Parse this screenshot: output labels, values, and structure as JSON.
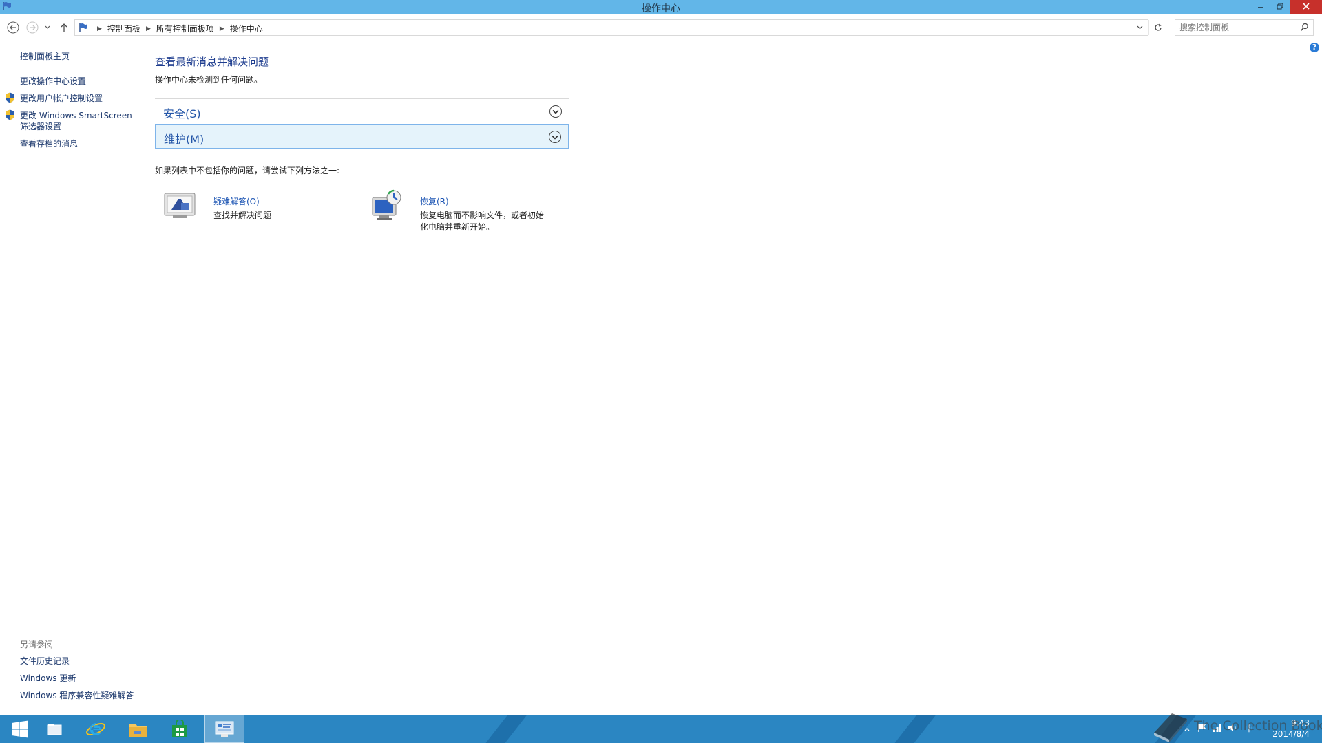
{
  "window": {
    "title": "操作中心"
  },
  "navigation": {
    "breadcrumbs": [
      "控制面板",
      "所有控制面板项",
      "操作中心"
    ],
    "search_placeholder": "搜索控制面板"
  },
  "sidebar": {
    "home_link": "控制面板主页",
    "links": [
      {
        "label": "更改操作中心设置",
        "shield": false
      },
      {
        "label": "更改用户帐户控制设置",
        "shield": true
      },
      {
        "label": "更改 Windows SmartScreen",
        "label2": "筛选器设置",
        "shield": true
      },
      {
        "label": "查看存档的消息",
        "shield": false
      }
    ],
    "see_also_title": "另请参阅",
    "see_also": [
      "文件历史记录",
      "Windows 更新",
      "Windows 程序兼容性疑难解答"
    ]
  },
  "main": {
    "heading": "查看最新消息并解决问题",
    "subtext": "操作中心未检测到任何问题。",
    "sections": [
      {
        "label": "安全(S)"
      },
      {
        "label": "维护(M)"
      }
    ],
    "hint": "如果列表中不包括你的问题，请尝试下列方法之一:",
    "tools": [
      {
        "title": "疑难解答(O)",
        "desc": "查找并解决问题",
        "icon": "troubleshoot-icon"
      },
      {
        "title": "恢复(R)",
        "desc": "恢复电脑而不影响文件，或者初始化电脑并重新开始。",
        "icon": "recovery-icon"
      }
    ]
  },
  "taskbar": {
    "items": [
      "start-icon",
      "explorer-tab-icon",
      "internet-explorer-icon",
      "file-explorer-icon",
      "store-icon",
      "control-panel-icon"
    ],
    "clock_time": "9:43",
    "clock_date": "2014/8/4",
    "ime": "中"
  },
  "watermark": {
    "text": "The Collection Book"
  },
  "colors": {
    "titlebar": "#62b6e8",
    "taskbar": "#2b86c2",
    "link": "#1e3a6e",
    "heading": "#1e3d8f",
    "close_button": "#c7302b"
  }
}
